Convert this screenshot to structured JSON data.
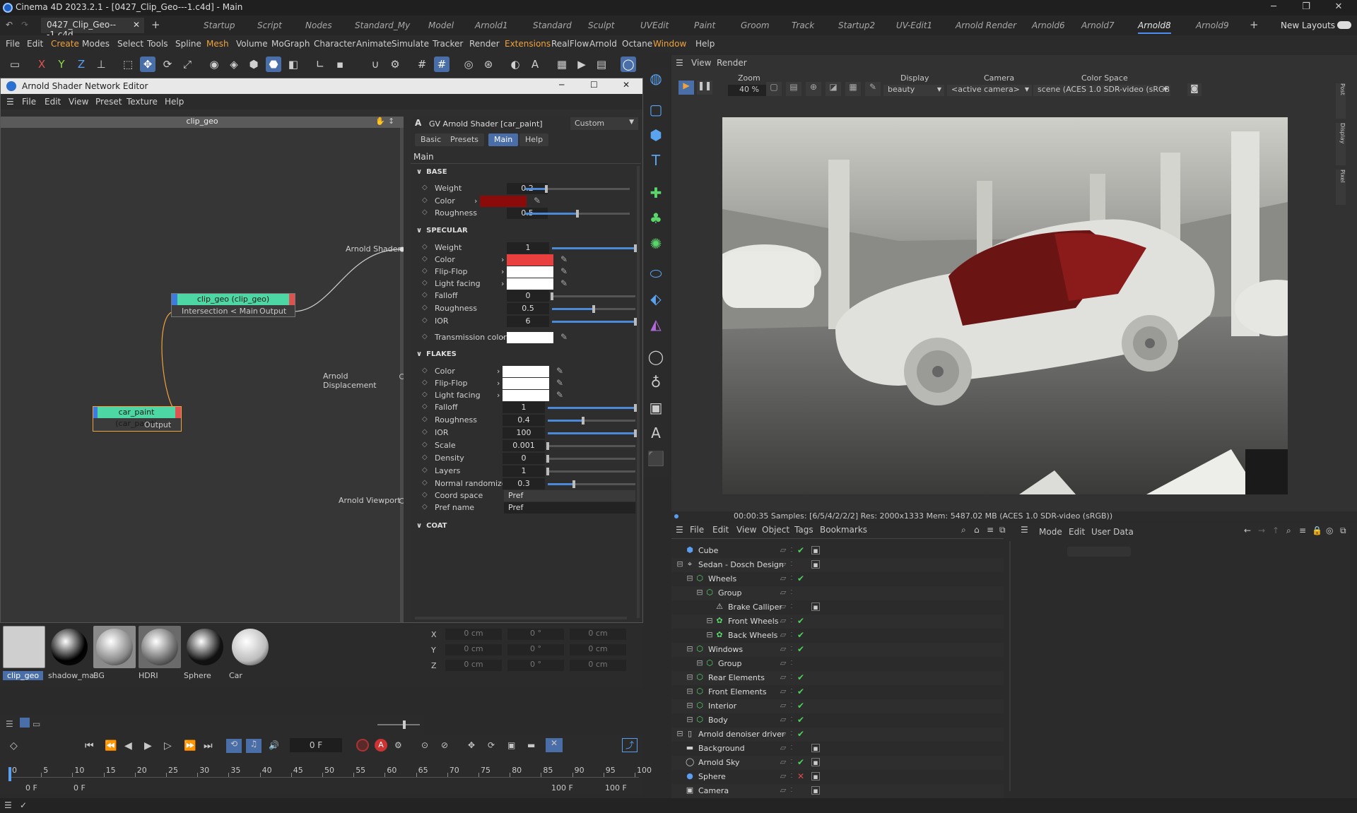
{
  "app": {
    "title": "Cinema 4D 2023.2.1 - [0427_Clip_Geo---1.c4d] - Main",
    "doc_tab": "0427_Clip_Geo---1.c4d",
    "new_layouts": "New Layouts"
  },
  "layout_tabs": [
    "Startup",
    "Script",
    "Nodes",
    "Standard_My",
    "Model",
    "Arnold1",
    "Standard",
    "Sculpt",
    "UVEdit",
    "Paint",
    "Groom",
    "Track",
    "Startup2",
    "UV-Edit1",
    "Arnold Render",
    "Arnold6",
    "Arnold7",
    "Arnold8",
    "Arnold9"
  ],
  "menu": [
    "File",
    "Edit",
    "Create",
    "Modes",
    "Select",
    "Tools",
    "Spline",
    "Mesh",
    "Volume",
    "MoGraph",
    "Character",
    "Animate",
    "Simulate",
    "Tracker",
    "Render",
    "Extensions",
    "RealFlow",
    "Arnold",
    "Octane",
    "Window",
    "Help"
  ],
  "toolbar_axes": [
    "X",
    "Y",
    "Z"
  ],
  "sne": {
    "title": "Arnold Shader Network Editor",
    "menu": [
      "File",
      "Edit",
      "View",
      "Preset",
      "Texture",
      "Help"
    ],
    "graph_title": "clip_geo",
    "node1": {
      "title": "clip_geo (clip_geo)",
      "in_port": "Intersection < Main",
      "out_port": "Output"
    },
    "node2": {
      "title": "car_paint (car_paint)",
      "out_port": "Output"
    },
    "root_ports": [
      "Arnold Shader",
      "Arnold Displacement",
      "Arnold Viewport"
    ]
  },
  "attr": {
    "header": "GV Arnold Shader [car_paint]",
    "preset": "Custom",
    "tabs": [
      "Basic",
      "Presets",
      "Main",
      "Help"
    ],
    "section": "Main",
    "base": {
      "label": "BASE",
      "weight_label": "Weight",
      "weight": "0.2",
      "color_label": "Color",
      "color": "#8b0a0a",
      "roughness_label": "Roughness",
      "roughness": "0.5"
    },
    "specular": {
      "label": "SPECULAR",
      "weight_label": "Weight",
      "weight": "1",
      "color_label": "Color",
      "color": "#ea3f3f",
      "flipflop_label": "Flip-Flop",
      "flipflop": "#ffffff",
      "lightfacing_label": "Light facing",
      "lightfacing": "#ffffff",
      "falloff_label": "Falloff",
      "falloff": "0",
      "roughness_label": "Roughness",
      "roughness": "0.5",
      "ior_label": "IOR",
      "ior": "6",
      "transmission_label": "Transmission color",
      "transmission": "#ffffff"
    },
    "flakes": {
      "label": "FLAKES",
      "color_label": "Color",
      "flipflop_label": "Flip-Flop",
      "lightfacing_label": "Light facing",
      "falloff_label": "Falloff",
      "falloff": "1",
      "roughness_label": "Roughness",
      "roughness": "0.4",
      "ior_label": "IOR",
      "ior": "100",
      "scale_label": "Scale",
      "scale": "0.001",
      "density_label": "Density",
      "density": "0",
      "layers_label": "Layers",
      "layers": "1",
      "normal_label": "Normal randomize",
      "normal": "0.3",
      "coord_label": "Coord space",
      "coord": "Pref",
      "prefname_label": "Pref name",
      "prefname": "Pref"
    },
    "coat_label": "COAT"
  },
  "materials": [
    {
      "name": "clip_geo",
      "bg": "#cfcfcf"
    },
    {
      "name": "shadow_ma",
      "bg": "#000000"
    },
    {
      "name": "BG",
      "bg": "#8a8a8a"
    },
    {
      "name": "HDRI",
      "bg": "#6a6a6a"
    },
    {
      "name": "Sphere",
      "bg": "#111111"
    },
    {
      "name": "Car",
      "bg": "#bdbdbd"
    }
  ],
  "coords": {
    "axes": [
      "X",
      "Y",
      "Z"
    ],
    "v1": "0 cm",
    "v2": "0 °",
    "v3": "0 cm"
  },
  "timeline": {
    "frame": "0 F",
    "ticks": [
      "0",
      "5",
      "10",
      "15",
      "20",
      "25",
      "30",
      "35",
      "40",
      "45",
      "50",
      "55",
      "60",
      "65",
      "70",
      "75",
      "80",
      "85",
      "90",
      "95",
      "100"
    ],
    "start": "0 F",
    "start2": "0 F",
    "end": "100 F",
    "end2": "100 F"
  },
  "viewport": {
    "menu": [
      "View",
      "Render"
    ],
    "zoom_label": "Zoom",
    "zoom": "40 %",
    "display_label": "Display",
    "display": "beauty",
    "camera_label": "Camera",
    "camera": "<active camera>",
    "cs_label": "Color Space",
    "cs": "scene (ACES 1.0 SDR-video (sRGB))",
    "status": "00:00:35  Samples: [6/5/4/2/2/2]  Res: 2000x1333  Mem: 5487.02 MB  (ACES 1.0 SDR-video (sRGB))",
    "side_tabs": [
      "Post",
      "Display",
      "Pixel"
    ]
  },
  "objmgr": {
    "menu": [
      "File",
      "Edit",
      "View",
      "Object",
      "Tags",
      "Bookmarks"
    ],
    "rows": [
      {
        "name": "Cube",
        "indent": 0,
        "check": true
      },
      {
        "name": "Sedan - Dosch Design",
        "indent": 0,
        "check": false
      },
      {
        "name": "Wheels",
        "indent": 1,
        "check": true
      },
      {
        "name": "Group",
        "indent": 2,
        "check": false
      },
      {
        "name": "Brake Calliper",
        "indent": 3,
        "check": false
      },
      {
        "name": "Front Wheels",
        "indent": 3,
        "check": true
      },
      {
        "name": "Back Wheels",
        "indent": 3,
        "check": true
      },
      {
        "name": "Windows",
        "indent": 1,
        "check": true
      },
      {
        "name": "Group",
        "indent": 2,
        "check": false
      },
      {
        "name": "Rear Elements",
        "indent": 1,
        "check": true
      },
      {
        "name": "Front Elements",
        "indent": 1,
        "check": true
      },
      {
        "name": "Interior",
        "indent": 1,
        "check": true
      },
      {
        "name": "Body",
        "indent": 1,
        "check": true
      },
      {
        "name": "Arnold denoiser driver",
        "indent": 0,
        "check": true
      },
      {
        "name": "Background",
        "indent": 0,
        "check": false
      },
      {
        "name": "Arnold Sky",
        "indent": 0,
        "check": true
      },
      {
        "name": "Sphere",
        "indent": 0,
        "check": false
      },
      {
        "name": "Camera",
        "indent": 0,
        "check": false
      }
    ]
  },
  "attrmgr": {
    "menu": [
      "Mode",
      "Edit",
      "User Data"
    ]
  }
}
